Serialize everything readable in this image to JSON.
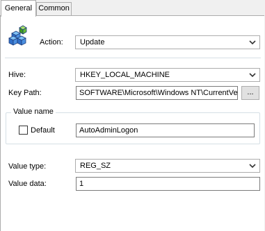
{
  "tabs": [
    {
      "label": "General"
    },
    {
      "label": "Common"
    }
  ],
  "action": {
    "label": "Action:",
    "value": "Update"
  },
  "hive": {
    "label": "Hive:",
    "value": "HKEY_LOCAL_MACHINE"
  },
  "key_path": {
    "label": "Key Path:",
    "value": "SOFTWARE\\Microsoft\\Windows NT\\CurrentVer",
    "browse_label": "..."
  },
  "value_name": {
    "group_title": "Value name",
    "default_label": "Default",
    "default_checked": false,
    "value": "AutoAdminLogon"
  },
  "value_type": {
    "label": "Value type:",
    "value": "REG_SZ"
  },
  "value_data": {
    "label": "Value data:",
    "value": "1"
  },
  "icons": {
    "registry": "registry-cubes-icon",
    "dropdown": "chevron-down-icon"
  }
}
